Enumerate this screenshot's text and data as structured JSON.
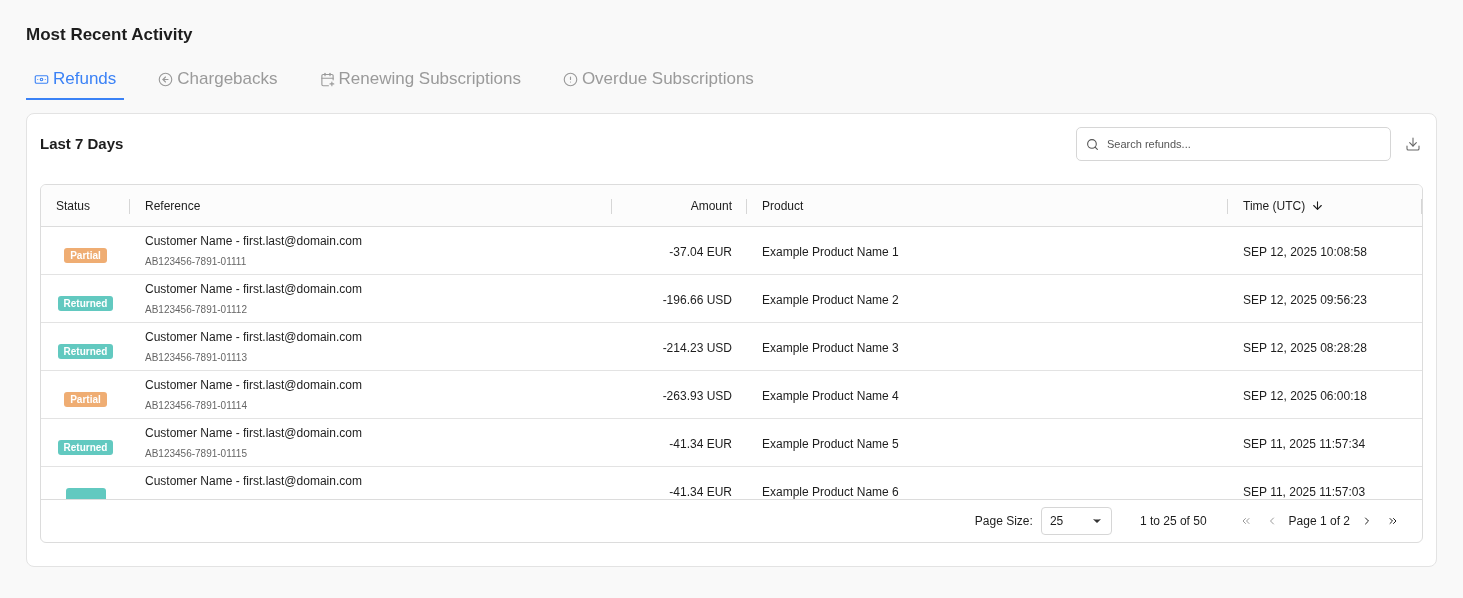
{
  "title": "Most Recent Activity",
  "tabs": [
    {
      "label": "Refunds",
      "selected": true
    },
    {
      "label": "Chargebacks",
      "selected": false
    },
    {
      "label": "Renewing Subscriptions",
      "selected": false
    },
    {
      "label": "Overdue Subscriptions",
      "selected": false
    }
  ],
  "panel": {
    "title": "Last 7 Days",
    "search": {
      "placeholder": "Search refunds..."
    }
  },
  "table": {
    "columns": [
      {
        "label": "Status",
        "sorted": false
      },
      {
        "label": "Reference",
        "sorted": false
      },
      {
        "label": "Amount",
        "sorted": false
      },
      {
        "label": "Product",
        "sorted": false
      },
      {
        "label": "Time (UTC)",
        "sorted": true
      }
    ],
    "rows": [
      {
        "status": {
          "kind": "partial",
          "label": "Partial"
        },
        "customer": "Customer Name - first.last@domain.com",
        "reference": "AB123456-7891-01111",
        "amount": "-37.04 EUR",
        "product": "Example Product Name 1",
        "time": "SEP 12, 2025 10:08:58"
      },
      {
        "status": {
          "kind": "returned",
          "label": "Returned"
        },
        "customer": "Customer Name - first.last@domain.com",
        "reference": "AB123456-7891-01112",
        "amount": "-196.66 USD",
        "product": "Example Product Name 2",
        "time": "SEP 12, 2025 09:56:23"
      },
      {
        "status": {
          "kind": "returned",
          "label": "Returned"
        },
        "customer": "Customer Name - first.last@domain.com",
        "reference": "AB123456-7891-01113",
        "amount": "-214.23 USD",
        "product": "Example Product Name 3",
        "time": "SEP 12, 2025 08:28:28"
      },
      {
        "status": {
          "kind": "partial",
          "label": "Partial"
        },
        "customer": "Customer Name - first.last@domain.com",
        "reference": "AB123456-7891-01114",
        "amount": "-263.93 USD",
        "product": "Example Product Name 4",
        "time": "SEP 12, 2025 06:00:18"
      },
      {
        "status": {
          "kind": "returned",
          "label": "Returned"
        },
        "customer": "Customer Name - first.last@domain.com",
        "reference": "AB123456-7891-01115",
        "amount": "-41.34 EUR",
        "product": "Example Product Name 5",
        "time": "SEP 11, 2025 11:57:34"
      },
      {
        "status": {
          "kind": "returned"
        },
        "customer": "Customer Name - first.last@domain.com",
        "amount": "-41.34 EUR",
        "product": "Example Product Name 6",
        "time": "SEP 11, 2025 11:57:03"
      }
    ]
  },
  "pagination": {
    "page_size_label": "Page Size:",
    "page_size": "25",
    "range": "1 to 25 of 50",
    "page": "Page 1 of 2"
  }
}
